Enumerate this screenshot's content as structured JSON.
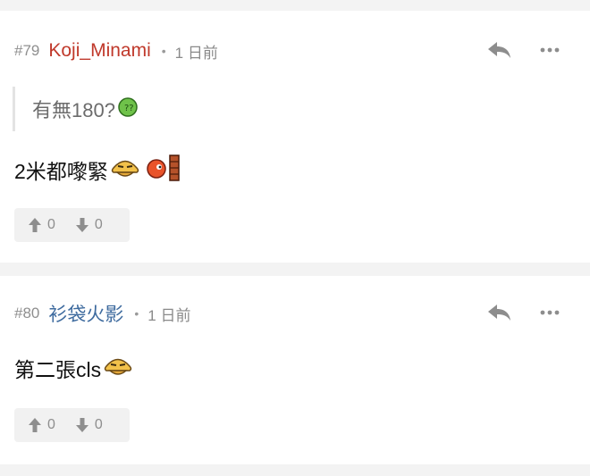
{
  "posts": [
    {
      "number": "#79",
      "username": "Koji_Minami",
      "username_color": "#c0392b",
      "time": "1 日前",
      "quote": "有無180?",
      "content": "2米都嚟緊",
      "upvotes": "0",
      "downvotes": "0",
      "icons": [
        "reply-icon",
        "more-icon",
        "question-emoji-icon",
        "sly-face-emoji-icon",
        "fireball-emoji-icon",
        "brick-emoji-icon",
        "thumb-up-icon",
        "thumb-down-icon"
      ]
    },
    {
      "number": "#80",
      "username": "衫袋火影",
      "username_color": "#3d6a9e",
      "time": "1 日前",
      "content": "第二張cls",
      "upvotes": "0",
      "downvotes": "0",
      "icons": [
        "reply-icon",
        "more-icon",
        "sly-face-emoji-icon",
        "thumb-up-icon",
        "thumb-down-icon"
      ]
    }
  ]
}
